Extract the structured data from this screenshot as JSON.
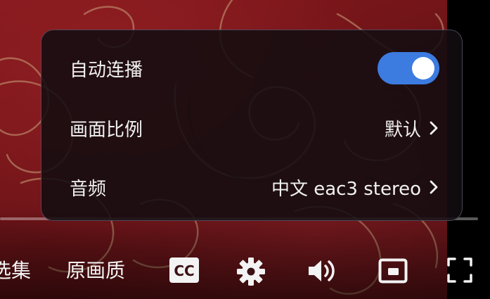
{
  "settings_panel": {
    "autoplay": {
      "label": "自动连播",
      "enabled": true
    },
    "aspect_ratio": {
      "label": "画面比例",
      "value": "默认"
    },
    "audio": {
      "label": "音频",
      "value": "中文 eac3 stereo"
    }
  },
  "controls": {
    "episodes_label": "选集",
    "quality_label": "原画质",
    "subtitles_icon": "cc-icon",
    "settings_icon": "gear-icon",
    "volume_icon": "volume-icon",
    "pip_icon": "picture-in-picture-icon",
    "fullscreen_icon": "fullscreen-icon"
  },
  "colors": {
    "toggle_on": "#3c7be0",
    "video_background": "#7a1a1f"
  }
}
